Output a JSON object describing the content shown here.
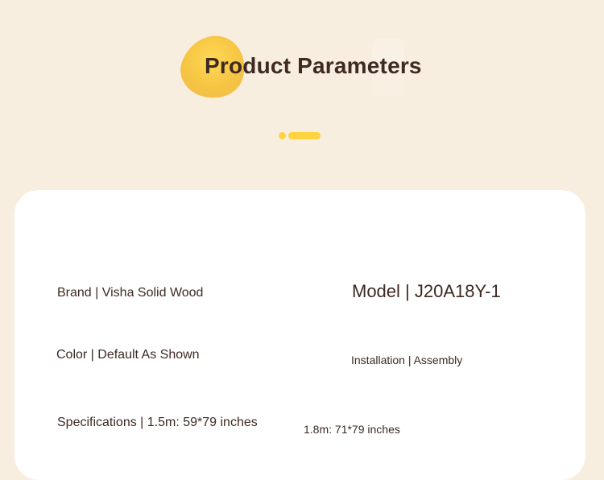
{
  "header": {
    "title": "Product Parameters"
  },
  "params": {
    "brand": "Brand | Visha Solid Wood",
    "model": "Model | J20A18Y-1",
    "color": "Color | Default As Shown",
    "installation": "Installation | Assembly",
    "specifications": "Specifications | 1.5m: 59*79 inches",
    "specifications_alt": "1.8m: 71*79 inches"
  },
  "colors": {
    "background": "#f8eedf",
    "accent": "#ffd23f",
    "card": "#ffffff",
    "text": "#3d2a22"
  }
}
